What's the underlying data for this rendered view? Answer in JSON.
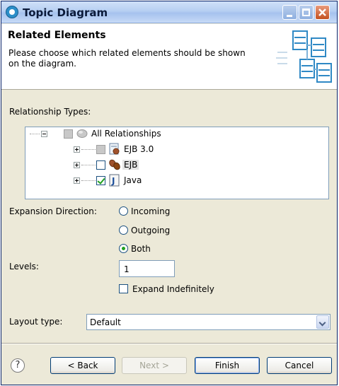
{
  "window": {
    "title": "Topic Diagram"
  },
  "header": {
    "title": "Related Elements",
    "description": "Please choose which related elements should be shown on the diagram."
  },
  "relationships": {
    "label": "Relationship Types:",
    "tree": [
      {
        "label": "All Relationships",
        "checked": false,
        "icon": "relationship-icon"
      },
      {
        "label": "EJB 3.0",
        "checked": false,
        "icon": "ejb30-bean-icon"
      },
      {
        "label": "EJB",
        "checked": false,
        "icon": "ejb-bean-icon",
        "selected": true
      },
      {
        "label": "Java",
        "checked": true,
        "icon": "java-file-icon"
      }
    ]
  },
  "expansion": {
    "label": "Expansion Direction:",
    "options": [
      "Incoming",
      "Outgoing",
      "Both"
    ],
    "selected": "Both"
  },
  "levels": {
    "label": "Levels:",
    "value": "1",
    "expand_label": "Expand Indefinitely"
  },
  "layout": {
    "label": "Layout type:",
    "value": "Default"
  },
  "buttons": {
    "help": "?",
    "back": "< Back",
    "next": "Next >",
    "finish": "Finish",
    "cancel": "Cancel"
  },
  "colors": {
    "titlebar": "#b7cff2",
    "close_button": "#c4501f",
    "check_mark": "#21a121"
  }
}
